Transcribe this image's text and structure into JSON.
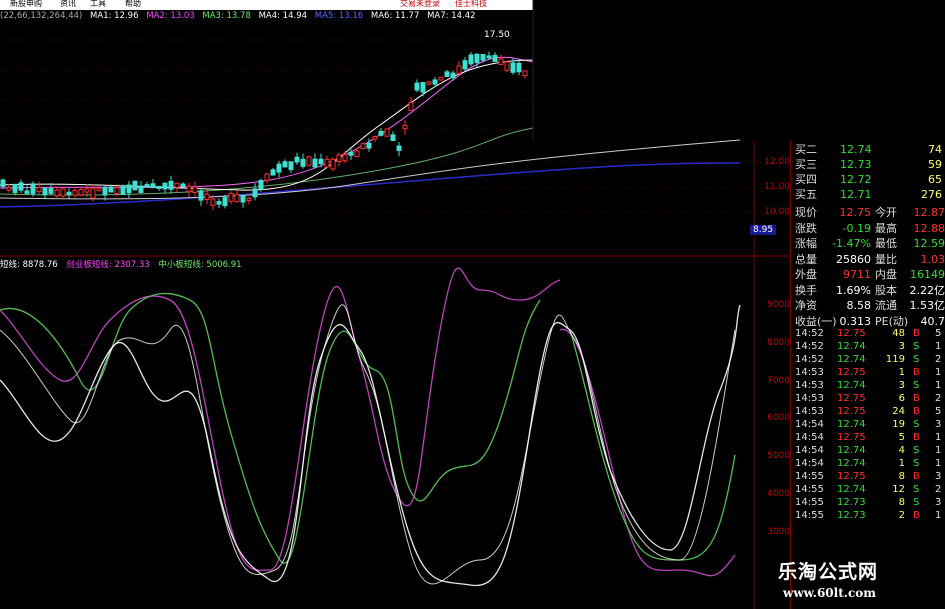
{
  "menu": {
    "items": [
      "新股申购",
      "资讯",
      "工具",
      "帮助"
    ],
    "ads": [
      "交易未登录",
      "佳士科技"
    ]
  },
  "ma_bar": {
    "params": "(22,66,132,264,44)",
    "items": [
      {
        "label": "MA1: 12.96",
        "color": "#ffffff"
      },
      {
        "label": "MA2: 13.03",
        "color": "#ff44ff"
      },
      {
        "label": "MA3: 13.78",
        "color": "#66ee66"
      },
      {
        "label": "MA4: 14.94",
        "color": "#ffffff"
      },
      {
        "label": "MA5: 13.16",
        "color": "#5566ff"
      },
      {
        "label": "MA6: 11.77",
        "color": "#ffffff"
      },
      {
        "label": "MA7: 14.42",
        "color": "#ffffff"
      }
    ]
  },
  "candles": {
    "peak_label": "17.50",
    "price_axis": [
      "12.00",
      "11.00",
      "10.00"
    ],
    "current_price_tag": "8.95"
  },
  "oscillator": {
    "items": [
      {
        "label": "短线: 8878.76",
        "color": "#ffffff"
      },
      {
        "label": "创业板短线: 2307.33",
        "color": "#ff44ff"
      },
      {
        "label": "中小板短线: 5006.91",
        "color": "#66ee66"
      }
    ],
    "axis": [
      "9000",
      "8000",
      "7000",
      "6000",
      "5000",
      "4000",
      "3000"
    ]
  },
  "quotes": {
    "bids": [
      {
        "label": "买二",
        "price": "12.74",
        "vol": "74"
      },
      {
        "label": "买三",
        "price": "12.73",
        "vol": "59"
      },
      {
        "label": "买四",
        "price": "12.72",
        "vol": "65"
      },
      {
        "label": "买五",
        "price": "12.71",
        "vol": "276"
      }
    ],
    "stats": [
      {
        "l1": "现价",
        "v1": "12.75",
        "l2": "今开",
        "v2": "12.87",
        "c1": "#ff3030",
        "c2": "#ff3030"
      },
      {
        "l1": "涨跌",
        "v1": "-0.19",
        "l2": "最高",
        "v2": "12.88",
        "c1": "#33dd33",
        "c2": "#ff3030"
      },
      {
        "l1": "涨幅",
        "v1": "-1.47%",
        "l2": "最低",
        "v2": "12.59",
        "c1": "#33dd33",
        "c2": "#33dd33"
      },
      {
        "l1": "总量",
        "v1": "25860",
        "l2": "量比",
        "v2": "1.03",
        "c1": "#ffffff",
        "c2": "#ff3030"
      },
      {
        "l1": "外盘",
        "v1": "9711",
        "l2": "内盘",
        "v2": "16149",
        "c1": "#ff3030",
        "c2": "#33dd33"
      },
      {
        "l1": "换手",
        "v1": "1.69%",
        "l2": "股本",
        "v2": "2.22亿",
        "c1": "#ffffff",
        "c2": "#ffffff"
      },
      {
        "l1": "净资",
        "v1": "8.58",
        "l2": "流通",
        "v2": "1.53亿",
        "c1": "#ffffff",
        "c2": "#ffffff"
      },
      {
        "l1": "收益(一)",
        "v1": "0.313",
        "l2": "PE(动)",
        "v2": "40.7",
        "c1": "#ffffff",
        "c2": "#ffffff"
      }
    ]
  },
  "ticks": [
    {
      "time": "14:52",
      "price": "12.75",
      "vol": "48",
      "side": "B",
      "n": "5"
    },
    {
      "time": "14:52",
      "price": "12.74",
      "vol": "3",
      "side": "S",
      "n": "1"
    },
    {
      "time": "14:52",
      "price": "12.74",
      "vol": "119",
      "side": "S",
      "n": "2"
    },
    {
      "time": "14:53",
      "price": "12.75",
      "vol": "1",
      "side": "B",
      "n": "1"
    },
    {
      "time": "14:53",
      "price": "12.74",
      "vol": "3",
      "side": "S",
      "n": "1"
    },
    {
      "time": "14:53",
      "price": "12.75",
      "vol": "6",
      "side": "B",
      "n": "2"
    },
    {
      "time": "14:53",
      "price": "12.75",
      "vol": "24",
      "side": "B",
      "n": "5"
    },
    {
      "time": "14:54",
      "price": "12.74",
      "vol": "19",
      "side": "S",
      "n": "3"
    },
    {
      "time": "14:54",
      "price": "12.75",
      "vol": "5",
      "side": "B",
      "n": "1"
    },
    {
      "time": "14:54",
      "price": "12.74",
      "vol": "4",
      "side": "S",
      "n": "1"
    },
    {
      "time": "14:54",
      "price": "12.74",
      "vol": "1",
      "side": "S",
      "n": "1"
    },
    {
      "time": "14:55",
      "price": "12.75",
      "vol": "8",
      "side": "B",
      "n": "3"
    },
    {
      "time": "14:55",
      "price": "12.74",
      "vol": "12",
      "side": "S",
      "n": "2"
    },
    {
      "time": "14:55",
      "price": "12.73",
      "vol": "8",
      "side": "S",
      "n": "3"
    },
    {
      "time": "14:55",
      "price": "12.73",
      "vol": "2",
      "side": "B",
      "n": "1"
    }
  ],
  "watermark": {
    "title": "乐淘公式网",
    "url": "www.60lt.com"
  },
  "colors": {
    "up": "#ff3030",
    "down": "#33dd33",
    "grid": "#7a0000"
  }
}
